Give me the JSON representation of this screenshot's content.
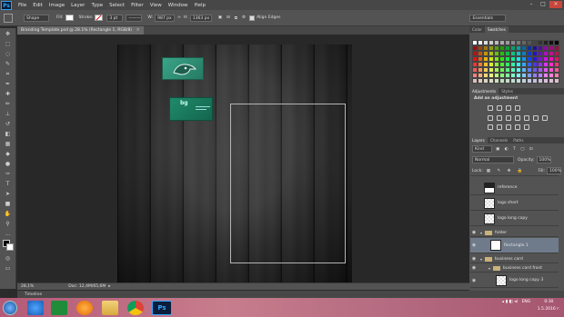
{
  "menubar": {
    "logo": "Ps",
    "items": [
      "File",
      "Edit",
      "Image",
      "Layer",
      "Type",
      "Select",
      "Filter",
      "View",
      "Window",
      "Help"
    ]
  },
  "options": {
    "mode": "Shape",
    "fill_label": "Fill:",
    "stroke_label": "Stroke:",
    "stroke_width": "3 pt",
    "w_label": "W:",
    "w_value": "987 px",
    "h_label": "H:",
    "h_value": "1363 px",
    "align_edges": "Align Edges",
    "workspace": "Essentials"
  },
  "document_tab": {
    "title": "Branding Template.psd @ 28.1% (Rectangle 1, RGB/8)",
    "close": "×"
  },
  "status": {
    "zoom": "28,1%",
    "doc": "Doc: 12,4M/65,6M"
  },
  "timeline": {
    "label": "Timeline"
  },
  "color_panel": {
    "tabs": [
      "Color",
      "Swatches"
    ]
  },
  "adjustments_panel": {
    "tabs": [
      "Adjustments",
      "Styles"
    ],
    "heading": "Add an adjustment"
  },
  "layers_panel": {
    "tabs": [
      "Layers",
      "Channels",
      "Paths"
    ],
    "kind": "Kind",
    "blend_mode": "Normal",
    "opacity_label": "Opacity:",
    "opacity_value": "100%",
    "lock_label": "Lock:",
    "fill_label": "Fill:",
    "fill_value": "100%",
    "layers": [
      {
        "name": "reference"
      },
      {
        "name": "logo short"
      },
      {
        "name": "logo long copy"
      },
      {
        "name": "folder"
      },
      {
        "name": "Rectangle 1"
      },
      {
        "name": "business card"
      },
      {
        "name": "business card front"
      },
      {
        "name": "logo long copy 3"
      }
    ]
  },
  "card": {
    "logo_text": "bg"
  },
  "tray": {
    "lang": "ENG",
    "time": "0:30",
    "date": "1.5.2016 г."
  }
}
